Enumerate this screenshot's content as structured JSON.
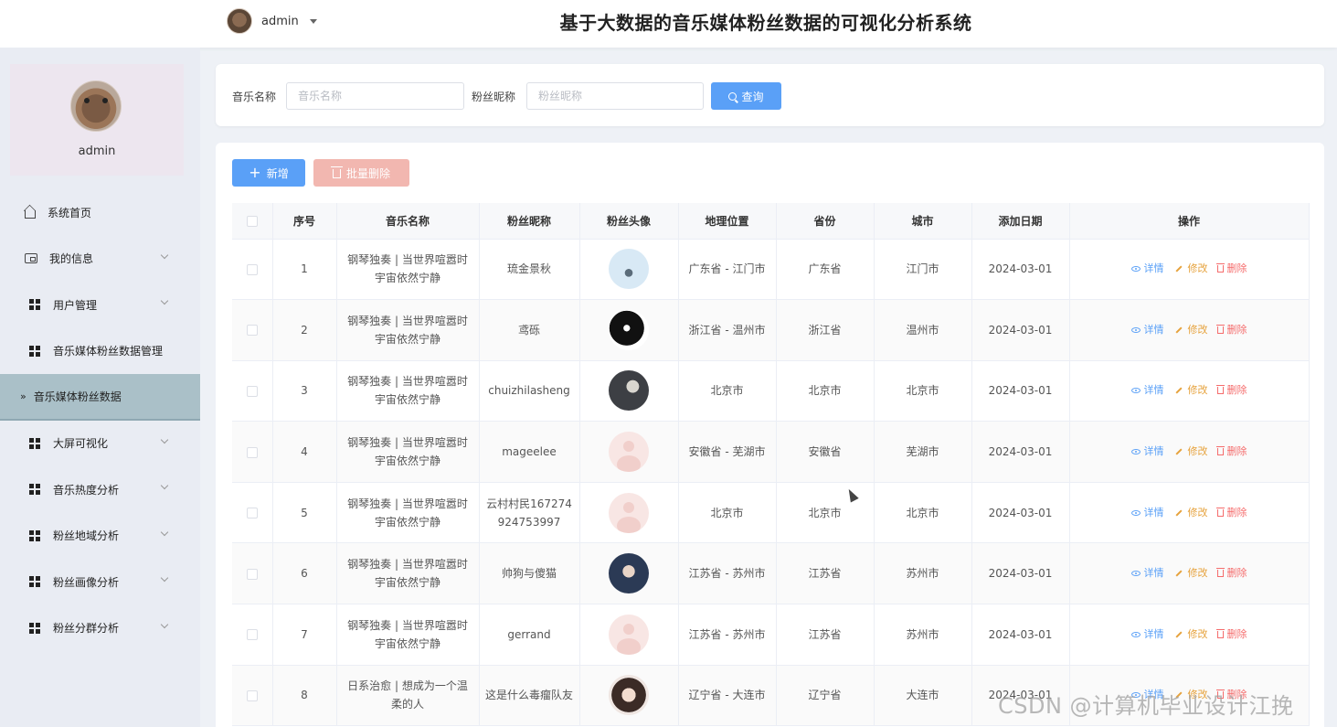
{
  "header": {
    "title": "基于大数据的音乐媒体粉丝数据的可视化分析系统",
    "username": "admin"
  },
  "sidebar": {
    "profile_name": "admin",
    "items": [
      {
        "label": "系统首页",
        "icon": "home-icon",
        "expandable": false
      },
      {
        "label": "我的信息",
        "icon": "wallet-icon",
        "expandable": true
      },
      {
        "label": "用户管理",
        "icon": "grid-icon",
        "expandable": true
      },
      {
        "label": "音乐媒体粉丝数据管理",
        "icon": "grid-icon",
        "expandable": false
      },
      {
        "label": "音乐媒体粉丝数据",
        "icon": "",
        "expandable": false,
        "active": true
      },
      {
        "label": "大屏可视化",
        "icon": "grid-icon",
        "expandable": true
      },
      {
        "label": "音乐热度分析",
        "icon": "grid-icon",
        "expandable": true
      },
      {
        "label": "粉丝地域分析",
        "icon": "grid-icon",
        "expandable": true
      },
      {
        "label": "粉丝画像分析",
        "icon": "grid-icon",
        "expandable": true
      },
      {
        "label": "粉丝分群分析",
        "icon": "grid-icon",
        "expandable": true
      }
    ]
  },
  "search": {
    "music_label": "音乐名称",
    "music_placeholder": "音乐名称",
    "music_value": "",
    "fan_label": "粉丝昵称",
    "fan_placeholder": "粉丝昵称",
    "fan_value": "",
    "query_label": "查询"
  },
  "toolbar": {
    "add_label": "新增",
    "batch_delete_label": "批量删除"
  },
  "table": {
    "columns": [
      "序号",
      "音乐名称",
      "粉丝昵称",
      "粉丝头像",
      "地理位置",
      "省份",
      "城市",
      "添加日期",
      "操作"
    ],
    "actions": {
      "detail": "详情",
      "edit": "修改",
      "delete": "删除"
    },
    "rows": [
      {
        "index": "1",
        "music": "钢琴独奏 | 当世界喧嚣时宇宙依然宁静",
        "nickname": "琉金景秋",
        "avatar": "avatar-penguin",
        "location": "广东省 - 江门市",
        "province": "广东省",
        "city": "江门市",
        "date": "2024-03-01"
      },
      {
        "index": "2",
        "music": "钢琴独奏 | 当世界喧嚣时宇宙依然宁静",
        "nickname": "鸢砾",
        "avatar": "avatar-ink",
        "location": "浙江省 - 温州市",
        "province": "浙江省",
        "city": "温州市",
        "date": "2024-03-01"
      },
      {
        "index": "3",
        "music": "钢琴独奏 | 当世界喧嚣时宇宙依然宁静",
        "nickname": "chuizhilasheng",
        "avatar": "avatar-cat",
        "location": "北京市",
        "province": "北京市",
        "city": "北京市",
        "date": "2024-03-01"
      },
      {
        "index": "4",
        "music": "钢琴独奏 | 当世界喧嚣时宇宙依然宁静",
        "nickname": "mageelee",
        "avatar": "avatar-default",
        "location": "安徽省 - 芜湖市",
        "province": "安徽省",
        "city": "芜湖市",
        "date": "2024-03-01"
      },
      {
        "index": "5",
        "music": "钢琴独奏 | 当世界喧嚣时宇宙依然宁静",
        "nickname": "云村村民167274924753997",
        "avatar": "avatar-default",
        "location": "北京市",
        "province": "北京市",
        "city": "北京市",
        "date": "2024-03-01"
      },
      {
        "index": "6",
        "music": "钢琴独奏 | 当世界喧嚣时宇宙依然宁静",
        "nickname": "帅狗与傻猫",
        "avatar": "avatar-anime-boy",
        "location": "江苏省 - 苏州市",
        "province": "江苏省",
        "city": "苏州市",
        "date": "2024-03-01"
      },
      {
        "index": "7",
        "music": "钢琴独奏 | 当世界喧嚣时宇宙依然宁静",
        "nickname": "gerrand",
        "avatar": "avatar-default",
        "location": "江苏省 - 苏州市",
        "province": "江苏省",
        "city": "苏州市",
        "date": "2024-03-01"
      },
      {
        "index": "8",
        "music": "日系治愈 | 想成为一个温柔的人",
        "nickname": "这是什么毒瘤队友",
        "avatar": "avatar-anime-girl",
        "location": "辽宁省 - 大连市",
        "province": "辽宁省",
        "city": "大连市",
        "date": "2024-03-01"
      }
    ]
  },
  "watermark": "CSDN @计算机毕业设计江挽",
  "colors": {
    "primary": "#5aa0f7",
    "danger_light": "#f2b7b0",
    "edit": "#e6a23c",
    "delete": "#f56c6c",
    "active_menu": "#aac0c8"
  }
}
